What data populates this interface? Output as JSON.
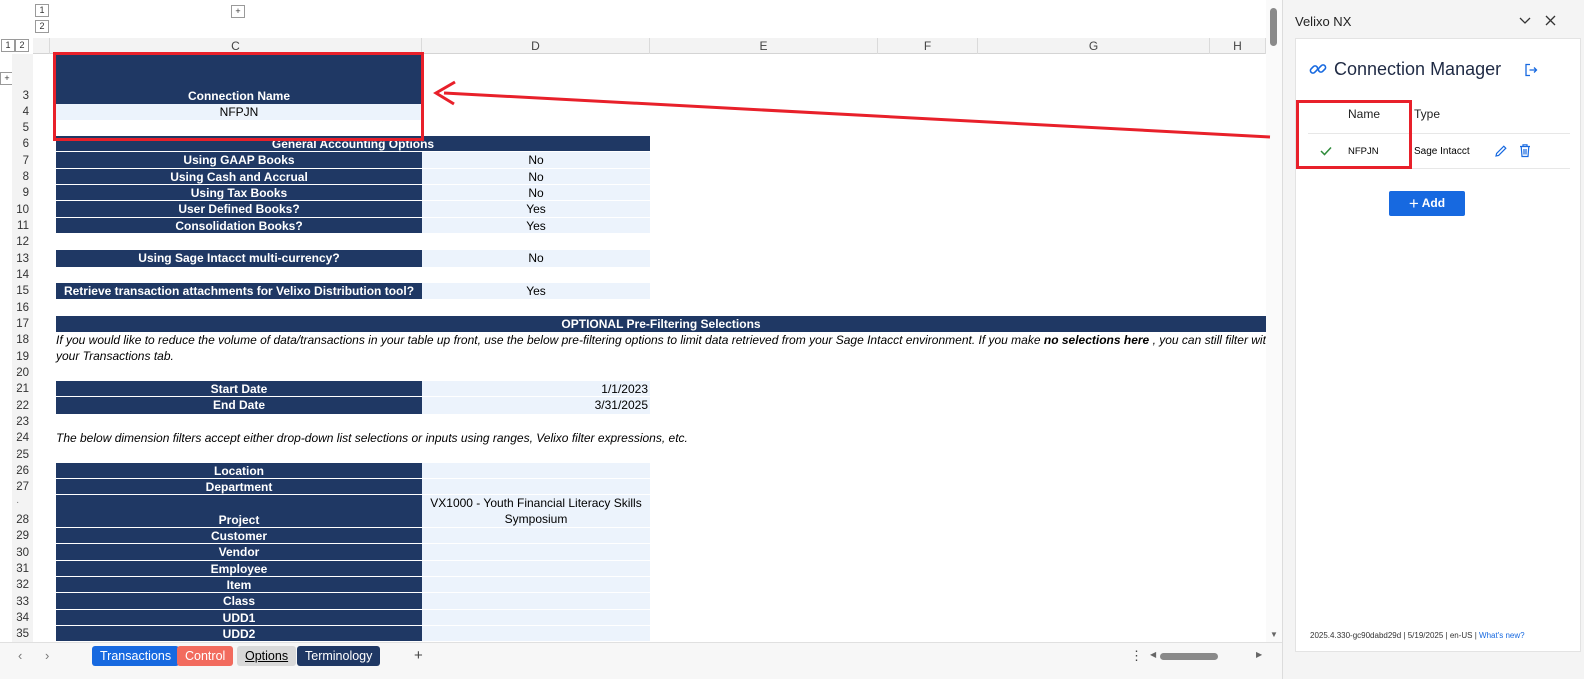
{
  "outline": {
    "row_levels": [
      "1",
      "2"
    ],
    "col_levels": [
      "1",
      "2"
    ],
    "expand": "+"
  },
  "columns": [
    "C",
    "D",
    "E",
    "F",
    "G",
    "H"
  ],
  "rows": [
    "3",
    "4",
    "5",
    "6",
    "7",
    "8",
    "9",
    "10",
    "11",
    "12",
    "13",
    "14",
    "15",
    "16",
    "17",
    "18",
    "19",
    "20",
    "21",
    "22",
    "23",
    "24",
    "25",
    "26",
    "27",
    "28",
    "29",
    "30",
    "31",
    "32",
    "33",
    "34",
    "35"
  ],
  "connection": {
    "header": "Connection Name",
    "value": "NFPJN"
  },
  "general": {
    "header": "General Accounting Options",
    "items": [
      {
        "label": "Using GAAP Books",
        "value": "No"
      },
      {
        "label": "Using Cash and Accrual",
        "value": "No"
      },
      {
        "label": "Using Tax Books",
        "value": "No"
      },
      {
        "label": "User Defined Books?",
        "value": "Yes"
      },
      {
        "label": "Consolidation Books?",
        "value": "Yes"
      }
    ]
  },
  "multicurrency": {
    "label": "Using Sage Intacct multi-currency?",
    "value": "No"
  },
  "attachments": {
    "label": "Retrieve transaction attachments for Velixo Distribution tool?",
    "value": "Yes"
  },
  "prefilter": {
    "header": "OPTIONAL Pre-Filtering Selections",
    "note_pre": "If you would like to reduce the volume of data/transactions in your table up front, use the below pre-filtering options to limit data retrieved from your Sage Intacct environment. If you make ",
    "note_bold": "no selections here",
    "note_post": " , you can still filter within t",
    "note_line2": "your Transactions tab.",
    "start_label": "Start Date",
    "start_value": "1/1/2023",
    "end_label": "End Date",
    "end_value": "3/31/2025",
    "dim_note": "The below dimension filters accept either drop-down list selections or inputs using ranges, Velixo filter expressions, etc."
  },
  "dimensions": [
    {
      "label": "Location",
      "value": ""
    },
    {
      "label": "Department",
      "value": ""
    },
    {
      "label": "Project",
      "value_line1": "VX1000 - Youth Financial Literacy Skills",
      "value_line2": "Symposium"
    },
    {
      "label": "Customer",
      "value": ""
    },
    {
      "label": "Vendor",
      "value": ""
    },
    {
      "label": "Employee",
      "value": ""
    },
    {
      "label": "Item",
      "value": ""
    },
    {
      "label": "Class",
      "value": ""
    },
    {
      "label": "UDD1",
      "value": ""
    },
    {
      "label": "UDD2",
      "value": ""
    }
  ],
  "tabs": [
    {
      "label": "Transactions",
      "color": "#1769e0"
    },
    {
      "label": "Control",
      "color": "#f26b5e"
    },
    {
      "label": "Options",
      "color": "#d9d9d9"
    },
    {
      "label": "Terminology",
      "color": "#1f3864"
    }
  ],
  "tabbar": {
    "prev": "‹",
    "next": "›",
    "add": "+",
    "more": "⋮"
  },
  "pane": {
    "title": "Velixo NX",
    "heading": "Connection Manager",
    "col_name": "Name",
    "col_type": "Type",
    "connection_name": "NFPJN",
    "connection_type": "Sage Intacct",
    "add_label": "Add",
    "footer_text": "2025.4.330-gc90dabd29d | 5/19/2025 | en-US | ",
    "footer_link": "What's new?"
  },
  "colors": {
    "header_navy": "#1f3864",
    "value_fill": "#ecf3fc",
    "annotation_red": "#e8202a",
    "accent_blue": "#1769e0"
  }
}
